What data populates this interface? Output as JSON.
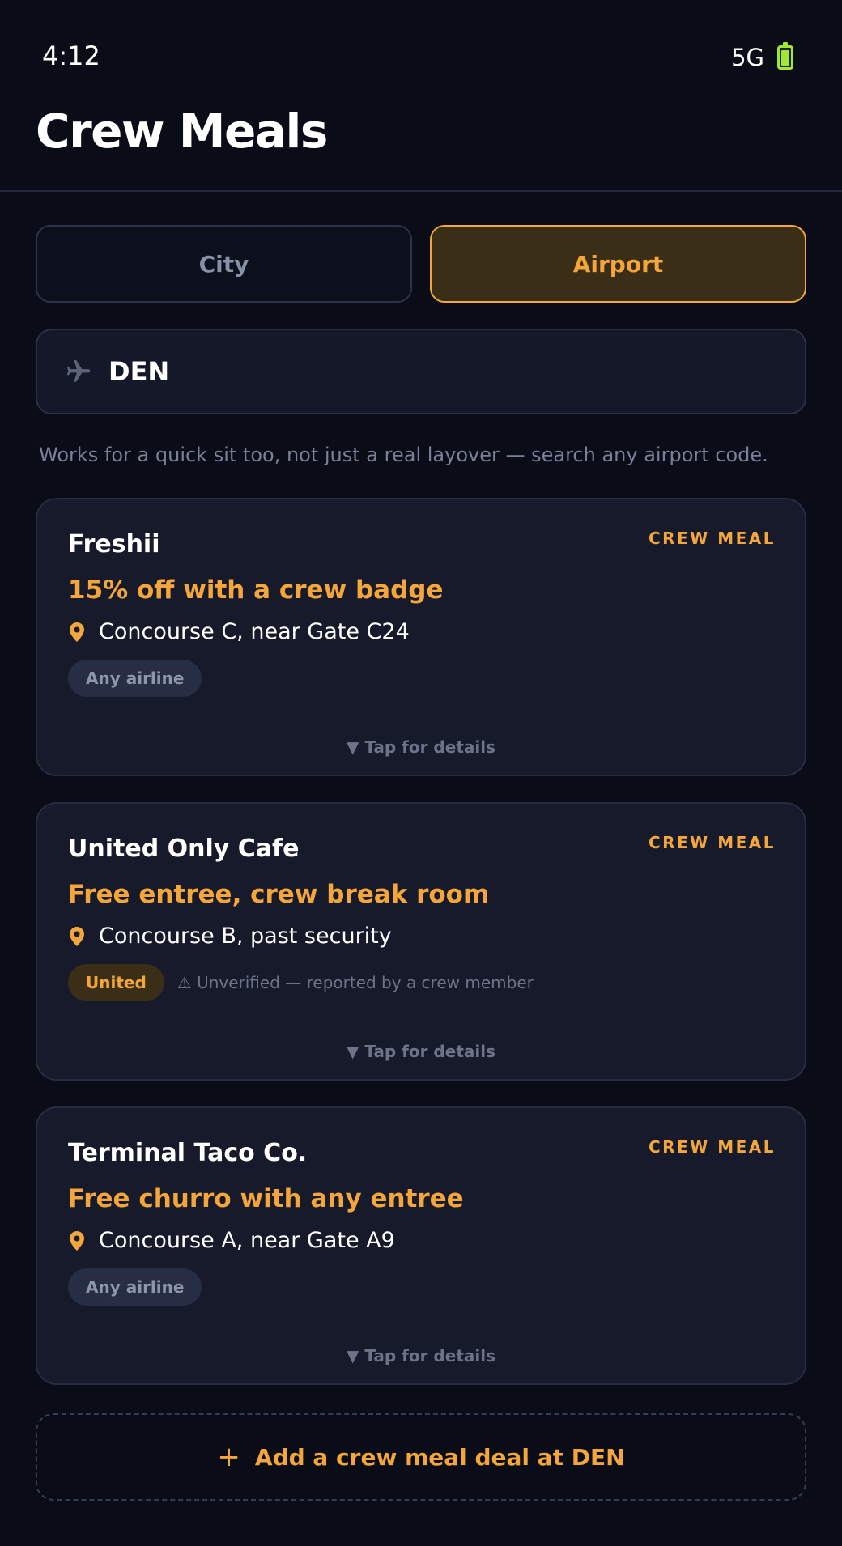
{
  "status_bar": {
    "time": "4:12",
    "network": "5G"
  },
  "header": {
    "title": "Crew Meals"
  },
  "mode_toggle": {
    "tabs": [
      {
        "label": "City",
        "active": false
      },
      {
        "label": "Airport",
        "active": true
      }
    ]
  },
  "search": {
    "value": "DEN",
    "icon": "plane-icon"
  },
  "hint": "Works for a quick sit too, not just a real layover — search any airport code.",
  "deals": [
    {
      "name": "Freshii",
      "tag": "CREW MEAL",
      "offer": "15% off with a crew badge",
      "location": "Concourse C, near Gate C24",
      "airline": "Any airline",
      "note": "",
      "expand_label": "▼ Tap for details"
    },
    {
      "name": "United Only Cafe",
      "tag": "CREW MEAL",
      "offer": "Free entree, crew break room",
      "location": "Concourse B, past security",
      "airline": "United",
      "note": "⚠ Unverified — reported by a crew member",
      "expand_label": "▼ Tap for details"
    },
    {
      "name": "Terminal Taco Co.",
      "tag": "CREW MEAL",
      "offer": "Free churro with any entree",
      "location": "Concourse A, near Gate A9",
      "airline": "Any airline",
      "note": "",
      "expand_label": "▼ Tap for details"
    }
  ],
  "add_deal": {
    "icon": "+",
    "label": "Add a crew meal deal at DEN"
  },
  "colors": {
    "accent": "#f5a63b",
    "background": "#0a0d17",
    "card": "#161a2a",
    "battery": "#a3e635"
  }
}
